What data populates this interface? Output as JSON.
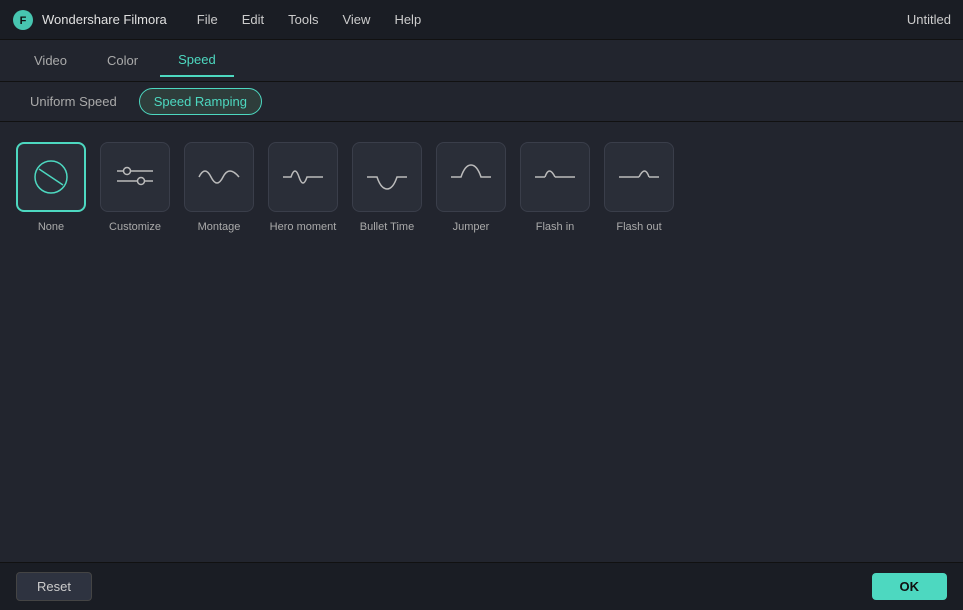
{
  "app": {
    "name": "Wondershare Filmora",
    "title": "Untitled"
  },
  "menu": {
    "items": [
      "File",
      "Edit",
      "Tools",
      "View",
      "Help"
    ]
  },
  "tabs": {
    "items": [
      "Video",
      "Color",
      "Speed"
    ],
    "active": "Speed"
  },
  "subtabs": {
    "items": [
      "Uniform Speed",
      "Speed Ramping"
    ],
    "active": "Speed Ramping"
  },
  "presets": [
    {
      "id": "none",
      "label": "None",
      "type": "none"
    },
    {
      "id": "customize",
      "label": "Customize",
      "type": "customize"
    },
    {
      "id": "montage",
      "label": "Montage",
      "type": "montage"
    },
    {
      "id": "hero-moment",
      "label": "Hero moment",
      "type": "hero"
    },
    {
      "id": "bullet-time",
      "label": "Bullet Time",
      "type": "bullet"
    },
    {
      "id": "jumper",
      "label": "Jumper",
      "type": "jumper"
    },
    {
      "id": "flash-in",
      "label": "Flash in",
      "type": "flash-in"
    },
    {
      "id": "flash-out",
      "label": "Flash out",
      "type": "flash-out"
    }
  ],
  "buttons": {
    "reset": "Reset",
    "ok": "OK"
  }
}
